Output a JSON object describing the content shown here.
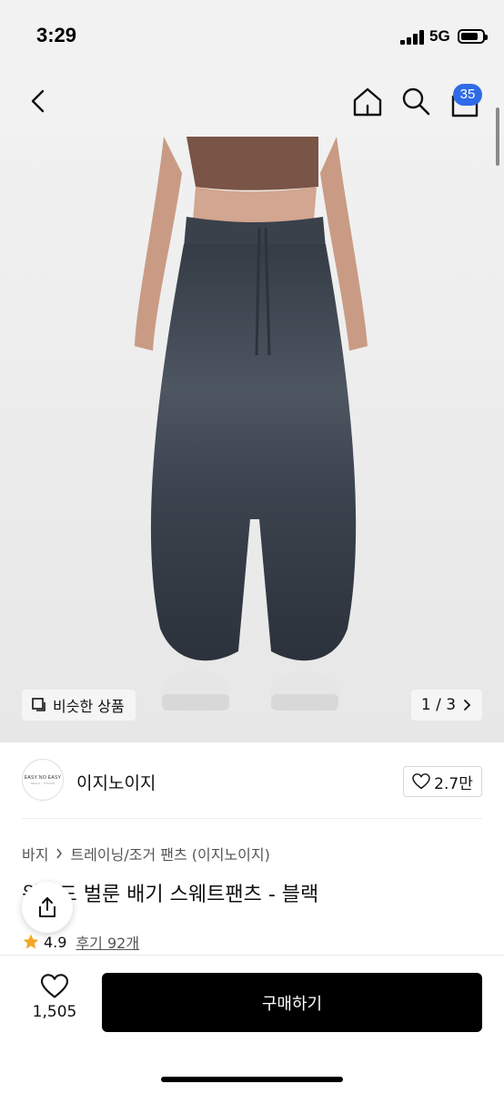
{
  "status_bar": {
    "time": "3:29",
    "network": "5G"
  },
  "nav": {
    "back_icon": "chevron-left-icon",
    "home_icon": "home-icon",
    "search_icon": "search-icon",
    "cart_icon": "shopping-bag-icon",
    "cart_count": "35",
    "badge_color": "#2f6be6"
  },
  "gallery": {
    "similar_label": "비슷한 상품",
    "page_indicator": "1 / 3",
    "image_description": "product-photo"
  },
  "brand": {
    "logo_line1": "EASY NO EASY",
    "logo_line2": "SEOUL · STUDIO",
    "name": "이지노이지",
    "like_count": "2.7만"
  },
  "product": {
    "breadcrumb": [
      "바지",
      "트레이닝/조거 팬츠 (이지노이지)"
    ],
    "title": "워싱드 벌룬 배기 스웨트팬츠 - 블랙",
    "rating": "4.9",
    "reviews_label": "후기 92개",
    "star_color": "#f5a623"
  },
  "bottom": {
    "like_count": "1,505",
    "buy_label": "구매하기"
  }
}
